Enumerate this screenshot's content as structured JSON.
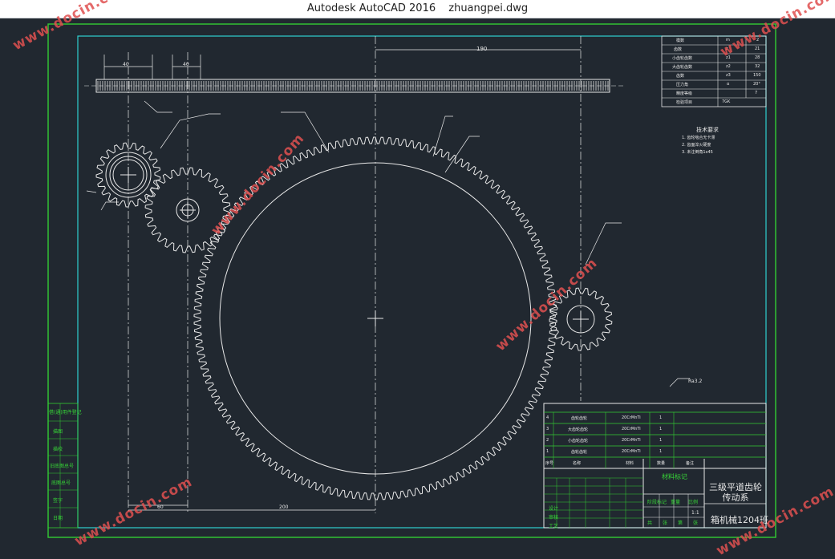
{
  "window": {
    "app": "Autodesk AutoCAD 2016",
    "file": "zhuangpei.dwg"
  },
  "title_block": {
    "drawing_name": "三级平道齿轮传动系",
    "class_name": "箱机械1204班",
    "material_mark": "材料标记",
    "scale": "1:1",
    "header_row": [
      "序号",
      "名称",
      "材料",
      "数量",
      "备注"
    ],
    "parts": [
      {
        "no": "4",
        "name": "齿轮齿轮",
        "spec": "20CrMnTi",
        "qty": "1"
      },
      {
        "no": "3",
        "name": "大齿轮齿轮",
        "spec": "20CrMnTi",
        "qty": "1"
      },
      {
        "no": "2",
        "name": "小齿轮齿轮",
        "spec": "20CrMnTi",
        "qty": "1"
      },
      {
        "no": "1",
        "name": "齿轮齿轮",
        "spec": "20CrMnTi",
        "qty": "1"
      }
    ],
    "sign_rows": [
      "设计",
      "审核",
      "工艺"
    ],
    "stage_labels": [
      "阶段标记",
      "重量",
      "比例"
    ],
    "bottom_labels": [
      "共",
      "张",
      "第",
      "张"
    ]
  },
  "param_table": {
    "rows": [
      [
        "模数",
        "m",
        "2"
      ],
      [
        "齿数",
        "z",
        "21"
      ],
      [
        "小齿轮齿数",
        "z1",
        "28"
      ],
      [
        "大齿轮齿数",
        "z2",
        "32"
      ],
      [
        "齿数",
        "z3",
        "150"
      ],
      [
        "压力角",
        "α",
        "20°"
      ],
      [
        "精度等级",
        "",
        "7"
      ],
      [
        "检验项目",
        "",
        "7GK"
      ]
    ]
  },
  "tech_notes": {
    "title": "技术要求",
    "lines": [
      "1. 齿轮啮合无卡滞",
      "2. 齿面淬火硬度",
      "3. 未注倒角1x45"
    ]
  },
  "left_stamp": [
    "借(通)用件登记",
    "描图",
    "描校",
    "旧底图总号",
    "底图总号",
    "签字",
    "日期"
  ],
  "dims": {
    "top": "190",
    "rack_a": "40",
    "rack_b": "40",
    "bottom_a": "60",
    "bottom_b": "200"
  },
  "roughness": "Ra3.2",
  "watermark": "www.docin.com"
}
